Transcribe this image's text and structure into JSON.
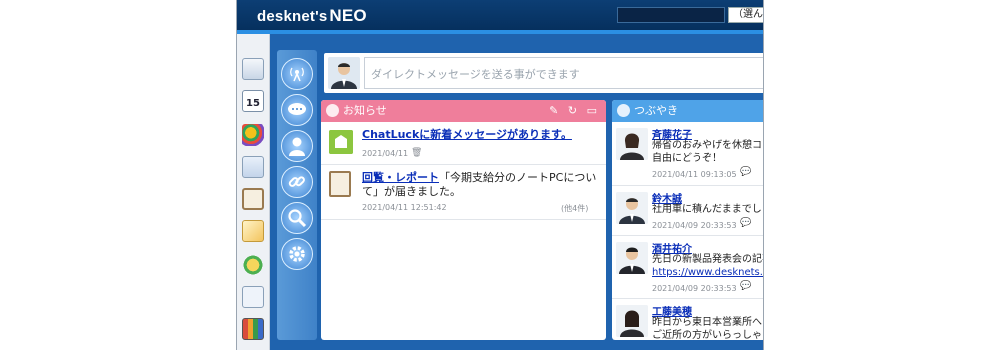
{
  "header": {
    "logo_main": "desknet's",
    "logo_neo": "NEO",
    "select_label": "（選んで"
  },
  "dm": {
    "placeholder": "ダイレクトメッセージを送る事ができます"
  },
  "notice": {
    "title": "お知らせ",
    "tools": "✎ ↻ ▭",
    "items": [
      {
        "title": "ChatLuckに新着メッセージがあります。",
        "date": "2021/04/11"
      },
      {
        "link": "回覧・レポート",
        "text": "「今期支給分のノートPCについて」が届きました。",
        "date": "2021/04/11 12:51:42",
        "count": "(他4件)"
      }
    ]
  },
  "tweets": {
    "title": "つぶやき",
    "items": [
      {
        "name": "斉藤花子",
        "lines": [
          "帰省のおみやげを休憩コー",
          "自由にどうぞ！"
        ],
        "date": "2021/04/11 09:13:05"
      },
      {
        "name": "鈴木誠",
        "lines": [
          "社用車に積んだままでし"
        ],
        "date": "2021/04/09 20:33:53"
      },
      {
        "name": "酒井祐介",
        "lines": [
          "先日の新製品発表会の記事"
        ],
        "link": "https://www.desknets.c",
        "date": "2021/04/09 20:33:53"
      },
      {
        "name": "工藤美穂",
        "lines": [
          "昨日から東日本営業所へ",
          "ご近所の方がいらっしゃ"
        ]
      }
    ]
  },
  "colors": {
    "header": "#06305e",
    "notice_header": "#ef7e9b",
    "tweet_header": "#4fa3e8",
    "app_bg": "#1f63ae"
  }
}
